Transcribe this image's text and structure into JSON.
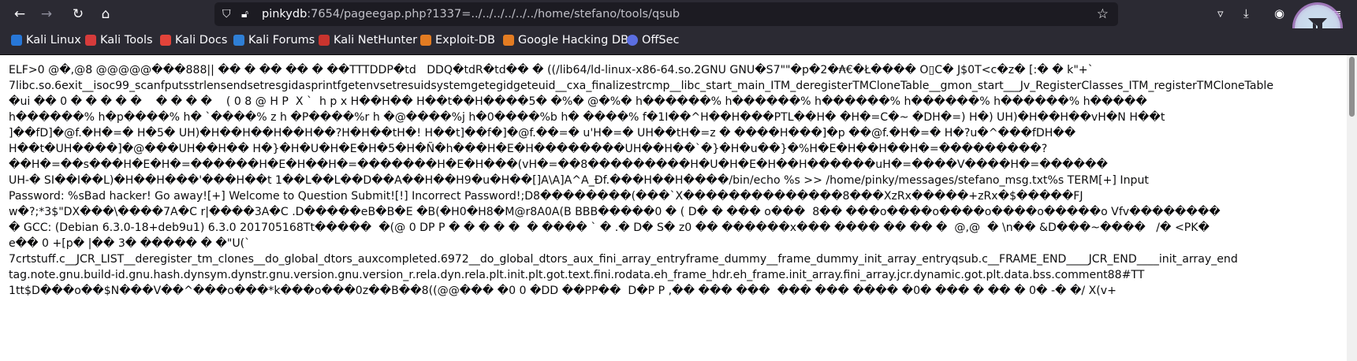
{
  "browser": {
    "url": {
      "host": "pinkydb",
      "rest": ":7654/pageegap.php?1337=../../../../../../home/stefano/tools/qsub"
    },
    "bookmarks": [
      {
        "label": "Kali Linux",
        "color": "#2777d8"
      },
      {
        "label": "Kali Tools",
        "color": "#d63b3b"
      },
      {
        "label": "Kali Docs",
        "color": "#e2433a"
      },
      {
        "label": "Kali Forums",
        "color": "#2f7fd6"
      },
      {
        "label": "Kali NetHunter",
        "color": "#c9342e"
      },
      {
        "label": "Exploit-DB",
        "color": "#e37c22"
      },
      {
        "label": "Google Hacking DB",
        "color": "#e37c22"
      },
      {
        "label": "OffSec",
        "color": "#5b6ee1"
      }
    ]
  },
  "content": {
    "lines": [
      "ELF>0 @�,@8 @@@@@���888|| �� � �� �� � ��TTTDDP�td   DDQ�tdR�td�� � ((/lib64/ld-linux-x86-64.so.2GNU GNU�S7\"\"�p�2�₳€�Ł���� O▯C� J$0T<c�z� [:� � k\"+`",
      "7libc.so.6exit__isoc99_scanfputsstrlensendsetresgidasprintfgetenvsetresuidsystemgetegidgeteuid__cxa_finalizestrcmp__libc_start_main_ITM_deregisterTMCloneTable__gmon_start___Jv_RegisterClasses_ITM_registerTMCloneTable",
      "�ui �� 0 � � � � �    � � � �    ( 0 8 @ H P  X `  h p x H��H�� H��t��H����5� �%� @�%� h������% h������% h������% h������% h������% h�����",
      "h������% h�p����% h� `����% z h �P����%r h �@����%j h�0����%b h� ����% f�1I��^H��H���PTL��H� �H�=C�~ �DH�=) H�) UH)�H��H��vH�N H��t",
      "]��fD]�@f.�H�=� H�5� UH)�H��H��H��H��?H�H��tH�! H��t]��f�]�@f.��=� u'H�=� UH��tH�=z � ����H���]�p ��@f.�H�=� H�?u�^���fDH��",
      "H��t�UH����]�@���UH��H�� H�}�H�U�H�E�H�5�H�Ñ�h���H�E�H��������UH��H��`�}�H�u��}�%H�E�H��H��H�=���������?",
      "��H�=��s���H�E�H�=������H�E�H��H�=�������H�E�H���(vH�=��8���������H�U�H�E�H��H������uH�=����V����H�=������",
      "UH-� SI��I��L)�H��H���'���H��t 1��L��L��D��A��H��H9�u�H��[]A\\A]A^A_Ðf.���H��H����/bin/echo %s >> /home/pinky/messages/stefano_msg.txt%s TERM[+] Input",
      "Password: %sBad hacker! Go away![+] Welcome to Question Submit![!] Incorrect Password!;D8��������(���`X��������������8���XzRx�����+zRx�$�����FJ",
      "w�?;*3$\"DX���\\����7A�C r|����3A�C .D�����eB�B�E �B(�H0�H8�M@r8A0A(B BBB�����0 � ( D� � ��� o���  8�� ���o����o����o����o�����o Vfv��������",
      "� GCC: (Debian 6.3.0-18+deb9u1) 6.3.0 201705168Tt�����  �(@ 0 DP P � � � � �  � ���� ` � .� D� S� z0 �� ������x��� ���� �� �� �  @,@  � \\n�� &D���~����   /� <PK�",
      "e�� 0 +[p� |�� 3� ����� � �\"U(`",
      "7crtstuff.c__JCR_LIST__deregister_tm_clones__do_global_dtors_auxcompleted.6972__do_global_dtors_aux_fini_array_entryframe_dummy__frame_dummy_init_array_entryqsub.c__FRAME_END____JCR_END____init_array_end",
      "tag.note.gnu.build-id.gnu.hash.dynsym.dynstr.gnu.version.gnu.version_r.rela.dyn.rela.plt.init.plt.got.text.fini.rodata.eh_frame_hdr.eh_frame.init_array.fini_array.jcr.dynamic.got.plt.data.bss.comment88#TT",
      "1tt$D���o��$N���V��^���o���*k���o���0z��B��8((@@��� �0 0 �DD ��PP��  D�P P ,�� ��� ���  ��� ��� ���� �0� ��� � �� � 0� -� �/ X(v+"
    ]
  }
}
